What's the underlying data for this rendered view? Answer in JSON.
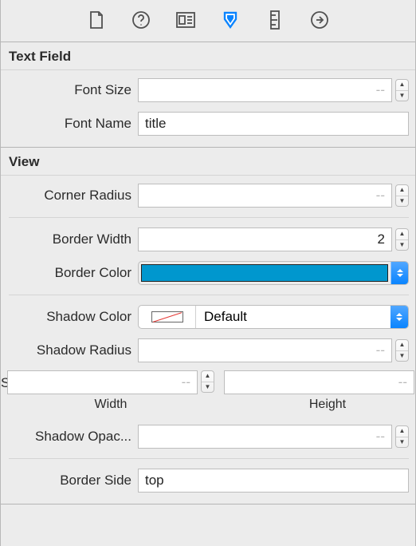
{
  "toolbar": {
    "active_index": 3
  },
  "sections": {
    "text_field": {
      "title": "Text Field",
      "font_size": {
        "label": "Font Size",
        "value": "",
        "placeholder": "--"
      },
      "font_name": {
        "label": "Font Name",
        "value": "title"
      }
    },
    "view": {
      "title": "View",
      "corner_radius": {
        "label": "Corner Radius",
        "value": "",
        "placeholder": "--"
      },
      "border_width": {
        "label": "Border Width",
        "value": "2"
      },
      "border_color": {
        "label": "Border Color",
        "swatch": "#0097ce"
      },
      "shadow_color": {
        "label": "Shadow Color",
        "value_label": "Default"
      },
      "shadow_radius": {
        "label": "Shadow Radius",
        "value": "",
        "placeholder": "--"
      },
      "shadow_offset": {
        "label": "Shadow Offset",
        "width": {
          "sublabel": "Width",
          "value": "",
          "placeholder": "--"
        },
        "height": {
          "sublabel": "Height",
          "value": "",
          "placeholder": "--"
        }
      },
      "shadow_opacity": {
        "label": "Shadow Opac...",
        "value": "",
        "placeholder": "--"
      },
      "border_side": {
        "label": "Border Side",
        "value": "top"
      }
    }
  }
}
